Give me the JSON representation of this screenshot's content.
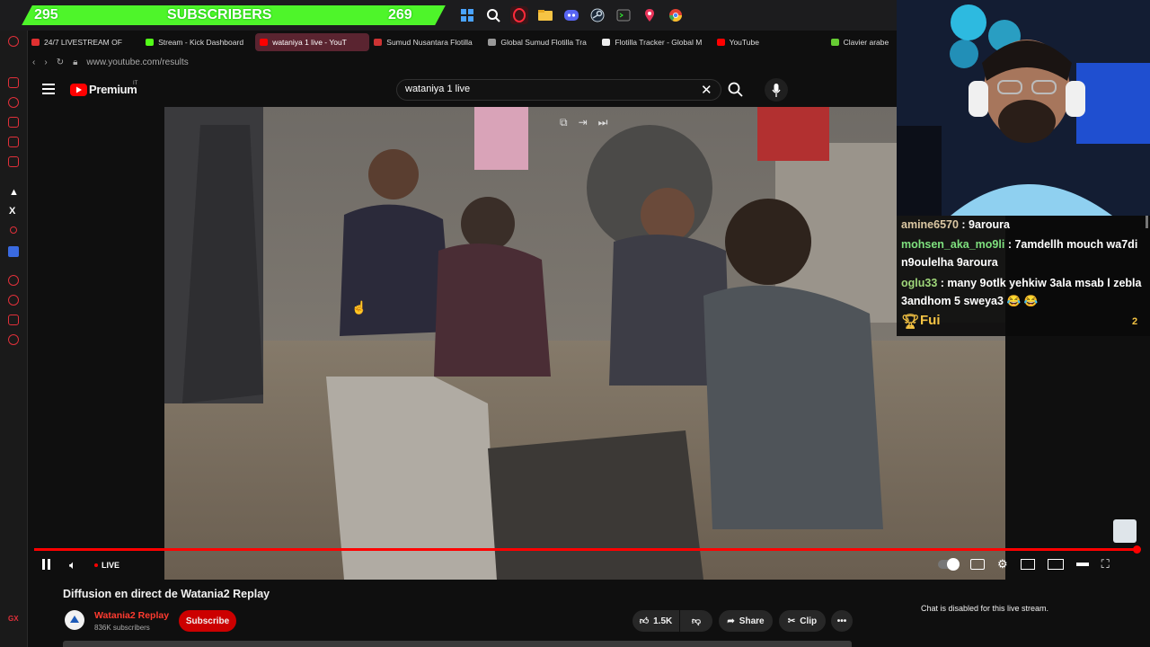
{
  "overlay": {
    "subs_left": "295",
    "subs_label": "SUBSCRIBERS",
    "subs_right": "269",
    "bar_color": "#4ef52a"
  },
  "tray_icons": [
    "windows-start-icon",
    "search-icon",
    "opera-gx-icon",
    "file-explorer-icon",
    "discord-icon",
    "steam-icon",
    "terminal-icon",
    "maps-pin-icon",
    "chrome-icon"
  ],
  "browser": {
    "tabs": [
      {
        "label": "24/7 LIVESTREAM OF",
        "color": "#e03030"
      },
      {
        "label": "Stream - Kick Dashboard",
        "color": "#53fc18"
      },
      {
        "label": "wataniya 1 live - YouT",
        "color": "#ff0000",
        "active": true
      },
      {
        "label": "Sumud Nusantara Flotilla",
        "color": "#c33"
      },
      {
        "label": "Global Sumud Flotilla Tra",
        "color": "#999"
      },
      {
        "label": "Flotilla Tracker - Global M",
        "color": "#eee"
      },
      {
        "label": "YouTube",
        "color": "#ff0000"
      },
      {
        "label": "Clavier arabe",
        "color": "#6c3"
      }
    ],
    "url": "www.youtube.com/results"
  },
  "youtube": {
    "logo_text": "Premium",
    "logo_sup": "IT",
    "search_value": "wataniya 1 live",
    "live_label": "LIVE",
    "video_title": "Diffusion en direct de Watania2 Replay",
    "channel_name": "Watania2 Replay",
    "channel_subs": "836K subscribers",
    "subscribe_label": "Subscribe",
    "like_count": "1.5K",
    "share_label": "Share",
    "clip_label": "Clip",
    "chat_disabled": "Chat is disabled for this live stream.",
    "progress": 1.0,
    "accent": "#ff0000"
  },
  "chat": {
    "messages": [
      {
        "user": "amine6570",
        "text": " : 9aroura",
        "color": "#dbc7a3"
      },
      {
        "user": "mohsen_aka_mo9li",
        "text": " : 7amdellh mouch wa7di n9oulelha 9aroura",
        "color": "#7ee07e"
      },
      {
        "user": "oglu33",
        "text": " : many 9otlk yehkiw 3ala msab l zebla 3andhom 5 sweya3",
        "color": "#9fd67a"
      }
    ],
    "emoji": "😂 😂",
    "poll_label": "Fui",
    "poll_count": "2"
  }
}
